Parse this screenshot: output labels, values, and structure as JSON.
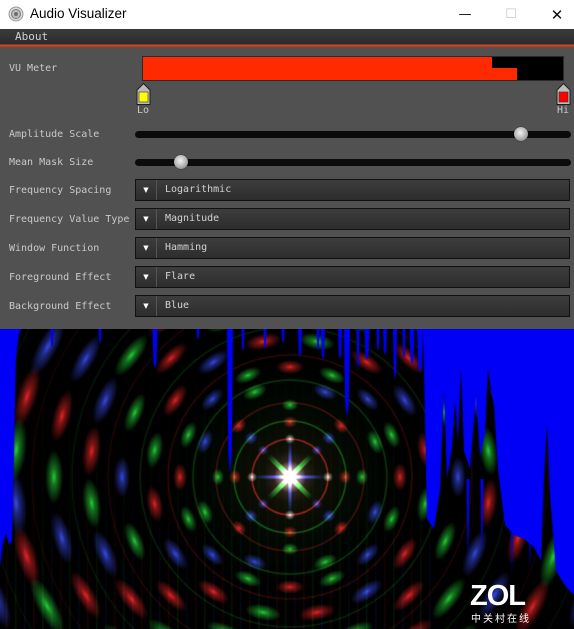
{
  "window": {
    "title": "Audio Visualizer",
    "app_icon": "speaker-icon",
    "controls": {
      "minimize": "—",
      "maximize": "☐",
      "close": "✕"
    }
  },
  "menu": {
    "items": [
      {
        "label": "About"
      }
    ]
  },
  "settings": {
    "vu_meter": {
      "label": "VU Meter",
      "levels": [
        0.83,
        0.89
      ],
      "bar_color": "#ff2a00",
      "lo_label": "Lo",
      "hi_label": "Hi",
      "lo_color": "#ffff00",
      "hi_color": "#ff0000"
    },
    "amplitude_scale": {
      "label": "Amplitude Scale",
      "value": 0.885
    },
    "mean_mask_size": {
      "label": "Mean Mask Size",
      "value": 0.105
    },
    "dropdowns": [
      {
        "label": "Frequency Spacing",
        "value": "Logarithmic"
      },
      {
        "label": "Frequency Value Type",
        "value": "Magnitude"
      },
      {
        "label": "Window Function",
        "value": "Hamming"
      },
      {
        "label": "Foreground Effect",
        "value": "Flare"
      },
      {
        "label": "Background Effect",
        "value": "Blue"
      }
    ],
    "dropdown_arrow": "▼"
  },
  "visualizer": {
    "background_color": "#0000f6",
    "flare_colors": {
      "red": "255,40,40",
      "green": "40,230,60",
      "blue": "60,80,255",
      "white": "255,255,255"
    },
    "watermark": {
      "brand": "ZOL",
      "subtitle": "中关村在线"
    }
  }
}
